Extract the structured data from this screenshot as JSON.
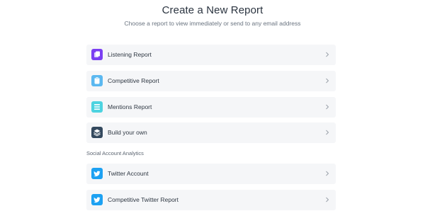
{
  "header": {
    "title": "Create a New Report",
    "subtitle": "Choose a report to view immediately or send to any email address"
  },
  "reports": [
    {
      "label": "Listening Report",
      "icon": "listening-report-icon",
      "color": "#7b3ff2"
    },
    {
      "label": "Competitive Report",
      "icon": "competitive-report-icon",
      "color": "#5bb8f0"
    },
    {
      "label": "Mentions Report",
      "icon": "mentions-report-icon",
      "color": "#4dd3e0"
    },
    {
      "label": "Build your own",
      "icon": "layers-icon",
      "color": "#34495e"
    }
  ],
  "social_section": {
    "label": "Social Account Analytics",
    "items": [
      {
        "label": "Twitter Account",
        "icon": "twitter-icon",
        "color": "#1da1f2"
      },
      {
        "label": "Competitive Twitter Report",
        "icon": "twitter-icon",
        "color": "#1da1f2"
      }
    ]
  },
  "colors": {
    "card_bg": "#f5f6f8",
    "chevron": "#9aa1aa"
  }
}
